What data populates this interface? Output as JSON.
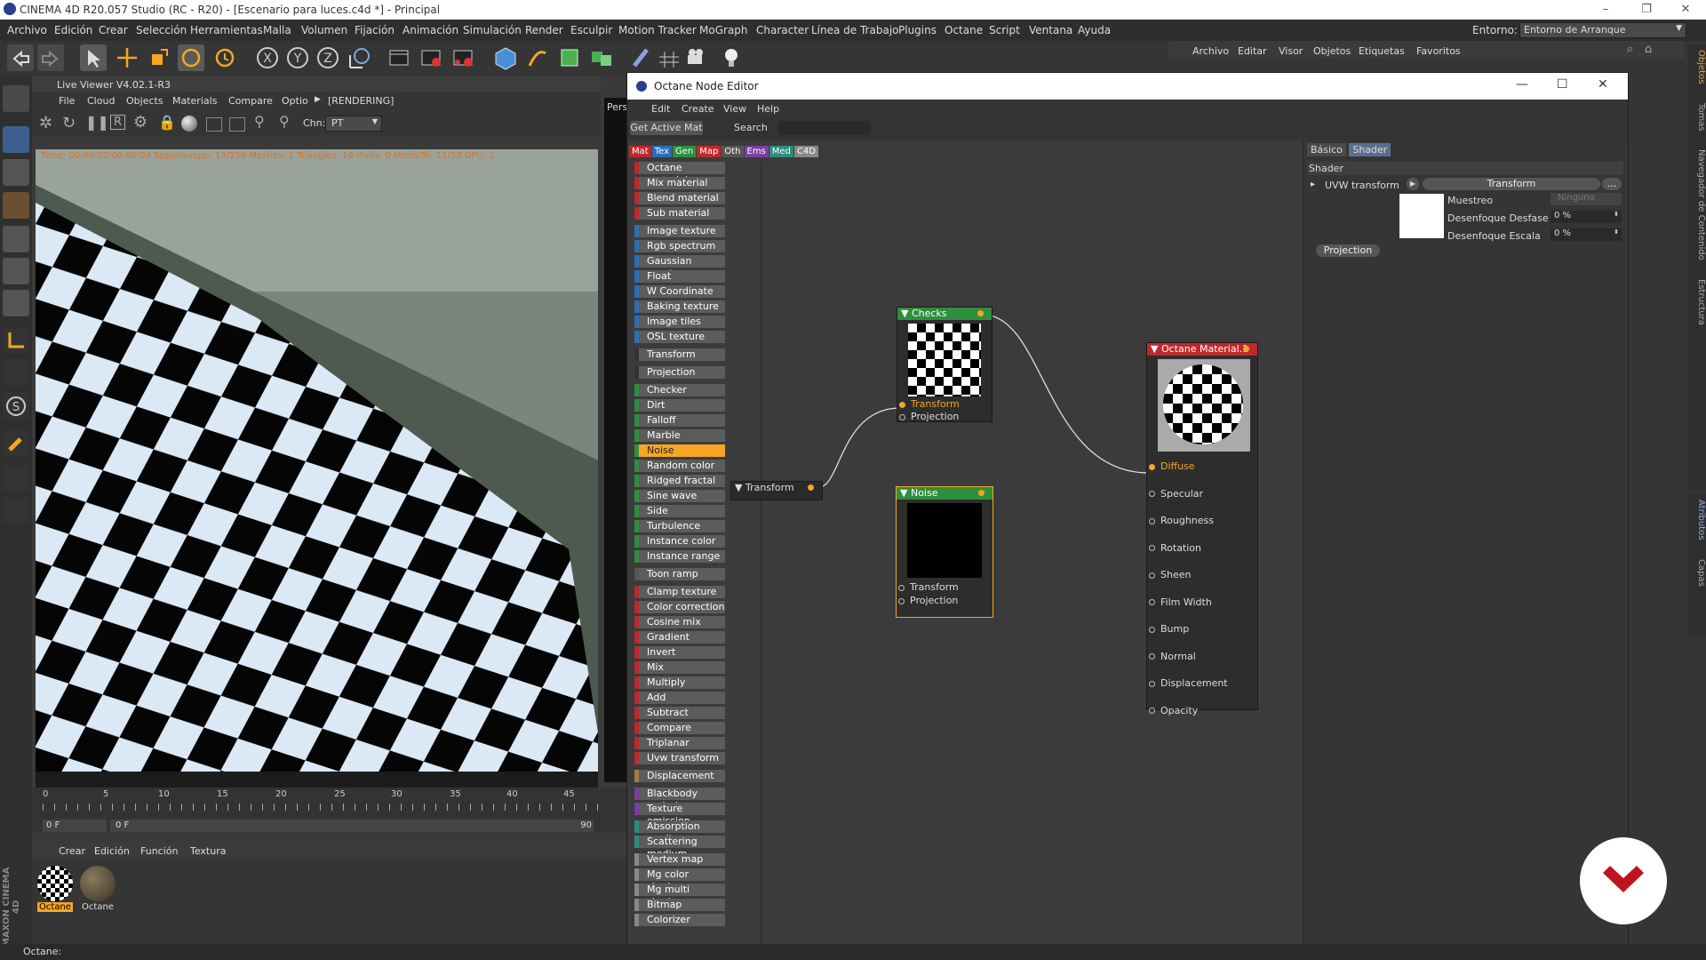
{
  "window": {
    "title": "CINEMA 4D R20.057 Studio (RC - R20) - [Escenario para luces.c4d *] - Principal"
  },
  "menubar": [
    "Archivo",
    "Edición",
    "Crear",
    "Selección",
    "Herramientas",
    "Malla",
    "Volumen",
    "Fijación",
    "Animación",
    "Simulación",
    "Render",
    "Esculpir",
    "Motion Tracker",
    "MoGraph",
    "Character",
    "Línea de Trabajo",
    "Plugins",
    "Octane",
    "Script",
    "Ventana",
    "Ayuda"
  ],
  "environment": {
    "label": "Entorno:",
    "value": "Entorno de Arranque"
  },
  "object_manager": {
    "menu": [
      "Archivo",
      "Editar",
      "Visor",
      "Objetos",
      "Etiquetas",
      "Favoritos"
    ]
  },
  "live_viewer": {
    "title": "Live Viewer V4.02.1-R3",
    "menu": [
      "File",
      "Cloud",
      "Objects",
      "Materials",
      "Compare",
      "Optio"
    ],
    "status": "[RENDERING]",
    "chn_label": "Chn:",
    "chn_value": "PT",
    "render_info": "Time: 00:00:02/00:00:04  Spp/maxspp: 13/256  Meshes: 1  Triangles: 16  Hairs: 0  Mesh/Tri: 11/33  GPU: 1"
  },
  "viewport_tab": "Pers",
  "timeline": {
    "ticks": [
      "0",
      "5",
      "10",
      "15",
      "20",
      "25",
      "30",
      "35",
      "40",
      "45"
    ],
    "frame_field": "0 F",
    "end_field": "0 F",
    "end_tick": "90"
  },
  "material_manager": {
    "menu": [
      "Crear",
      "Edición",
      "Función",
      "Textura"
    ],
    "materials": [
      {
        "name": "Octane",
        "selected": true
      },
      {
        "name": "Octane",
        "selected": false
      }
    ]
  },
  "node_editor": {
    "title": "Octane Node Editor",
    "menu": [
      "Edit",
      "Create",
      "View",
      "Help"
    ],
    "get_active_btn": "Get Active Mat",
    "search_label": "Search",
    "categories": [
      {
        "label": "Mat",
        "color": "#c0282c"
      },
      {
        "label": "Tex",
        "color": "#2a6fb5"
      },
      {
        "label": "Gen",
        "color": "#2e8f3e"
      },
      {
        "label": "Map",
        "color": "#c0282c"
      },
      {
        "label": "Oth",
        "color": "#555555"
      },
      {
        "label": "Ems",
        "color": "#7b3fa0"
      },
      {
        "label": "Med",
        "color": "#2c8c7a"
      },
      {
        "label": "C4D",
        "color": "#888888"
      }
    ],
    "node_list": [
      {
        "label": "Octane material",
        "color": "#c0282c"
      },
      {
        "label": "Mix material",
        "color": "#c0282c"
      },
      {
        "label": "Blend material",
        "color": "#c0282c"
      },
      {
        "label": "Sub material",
        "color": "#c0282c"
      },
      {
        "label": "Image texture",
        "color": "#2a6fb5",
        "gap": true
      },
      {
        "label": "Rgb spectrum",
        "color": "#2a6fb5"
      },
      {
        "label": "Gaussian spectrum",
        "color": "#2a6fb5"
      },
      {
        "label": "Float",
        "color": "#2a6fb5"
      },
      {
        "label": "W Coordinate",
        "color": "#2a6fb5"
      },
      {
        "label": "Baking texture",
        "color": "#2a6fb5"
      },
      {
        "label": "Image tiles",
        "color": "#2a6fb5"
      },
      {
        "label": "OSL texture",
        "color": "#2a6fb5"
      },
      {
        "label": "Transform",
        "color": "#333333",
        "gap": true
      },
      {
        "label": "Projection",
        "color": "#333333",
        "gap": true
      },
      {
        "label": "Checker",
        "color": "#2e8f3e",
        "gap": true
      },
      {
        "label": "Dirt",
        "color": "#2e8f3e"
      },
      {
        "label": "Falloff",
        "color": "#2e8f3e"
      },
      {
        "label": "Marble",
        "color": "#2e8f3e"
      },
      {
        "label": "Noise",
        "color": "#2e8f3e",
        "selected": true
      },
      {
        "label": "Random color",
        "color": "#2e8f3e"
      },
      {
        "label": "Ridged fractal",
        "color": "#2e8f3e"
      },
      {
        "label": "Sine wave",
        "color": "#2e8f3e"
      },
      {
        "label": "Side",
        "color": "#2e8f3e"
      },
      {
        "label": "Turbulence",
        "color": "#2e8f3e"
      },
      {
        "label": "Instance color",
        "color": "#2e8f3e"
      },
      {
        "label": "Instance range",
        "color": "#2e8f3e"
      },
      {
        "label": "Toon ramp",
        "color": "#555555",
        "gap": true
      },
      {
        "label": "Clamp texture",
        "color": "#c0282c",
        "gap": true
      },
      {
        "label": "Color correction",
        "color": "#c0282c"
      },
      {
        "label": "Cosine mix",
        "color": "#c0282c"
      },
      {
        "label": "Gradient",
        "color": "#c0282c"
      },
      {
        "label": "Invert",
        "color": "#c0282c"
      },
      {
        "label": "Mix",
        "color": "#c0282c"
      },
      {
        "label": "Multiply",
        "color": "#c0282c"
      },
      {
        "label": "Add",
        "color": "#c0282c"
      },
      {
        "label": "Subtract",
        "color": "#c0282c"
      },
      {
        "label": "Compare",
        "color": "#c0282c"
      },
      {
        "label": "Triplanar",
        "color": "#c0282c"
      },
      {
        "label": "Uvw transform",
        "color": "#c0282c"
      },
      {
        "label": "Displacement",
        "color": "#a08040",
        "gap": true
      },
      {
        "label": "Blackbody emission",
        "color": "#7b3fa0",
        "gap": true
      },
      {
        "label": "Texture emission",
        "color": "#7b3fa0"
      },
      {
        "label": "Absorption medium",
        "color": "#2c8c7a",
        "gap": true
      },
      {
        "label": "Scattering medium",
        "color": "#2c8c7a"
      },
      {
        "label": "Vertex map",
        "color": "#888888",
        "gap": true
      },
      {
        "label": "Mg color shader",
        "color": "#888888"
      },
      {
        "label": "Mg multi shader",
        "color": "#888888"
      },
      {
        "label": "Bitmap",
        "color": "#888888"
      },
      {
        "label": "Colorizer",
        "color": "#888888"
      }
    ],
    "nodes": {
      "checks": {
        "title": "Checks",
        "pins": [
          "Transform",
          "Projection"
        ]
      },
      "transform": {
        "title": "Transform"
      },
      "noise": {
        "title": "Noise",
        "pins": [
          "Transform",
          "Projection"
        ]
      },
      "material": {
        "title": "Octane Material.1",
        "pins": [
          "Diffuse",
          "Specular",
          "Roughness",
          "Rotation",
          "Sheen",
          "Film Width",
          "Bump",
          "Normal",
          "Displacement",
          "Opacity"
        ]
      }
    },
    "attributes": {
      "tabs": [
        "Básico",
        "Shader"
      ],
      "active_tab": "Shader",
      "section": "Shader",
      "uvw_label": "UVW transform",
      "uvw_value": "Transform",
      "uvw_more": "...",
      "muestreo_label": "Muestreo",
      "muestreo_value": "Ninguno",
      "desfase_label": "Desenfoque Desfase",
      "desfase_value": "0 %",
      "escala_label": "Desenfoque Escala",
      "escala_value": "0 %",
      "projection_btn": "Projection"
    }
  },
  "right_tabs": [
    "Objetos",
    "Tomas",
    "Navegador de Contenido",
    "Estructura"
  ],
  "right_tabs2": [
    "Atributos",
    "Capas"
  ],
  "brand": "MAXON CINEMA 4D",
  "status": "Octane:"
}
